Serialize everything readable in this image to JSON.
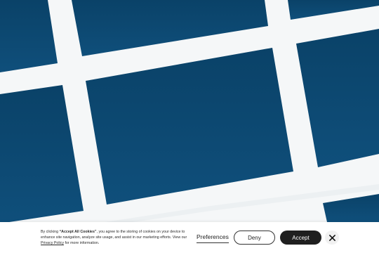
{
  "colors": {
    "tile": "#0b4770",
    "tile_light": "#155887",
    "background": "#f5f7f8",
    "accept_bg": "#1f1f1f"
  },
  "cookie_banner": {
    "text_prefix": "By clicking ",
    "text_emphasis": "“Accept All Cookies”",
    "text_middle": ", you agree to the storing of cookies on your device to enhance site navigation, analyze site usage, and assist in our marketing efforts. View our ",
    "privacy_link": "Privacy Policy",
    "text_suffix": " for more information.",
    "preferences_label": "Preferences",
    "deny_label": "Deny",
    "accept_label": "Accept",
    "close_icon": "close-icon"
  }
}
